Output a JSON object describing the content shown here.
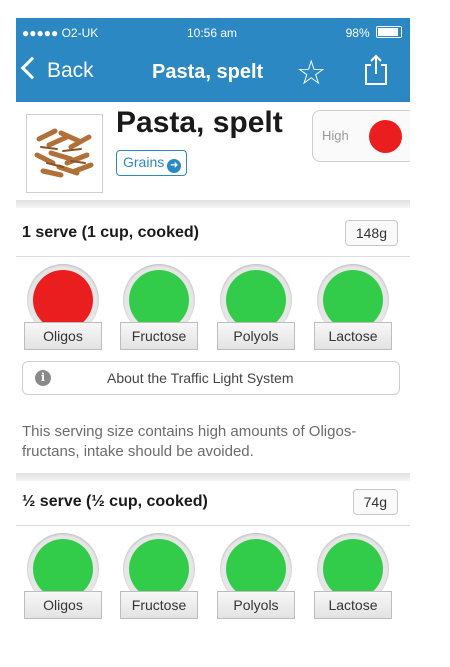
{
  "status_bar": {
    "carrier": "●●●●● O2-UK",
    "time": "10:56 am",
    "battery": "98%"
  },
  "nav": {
    "back_label": "Back",
    "title": "Pasta, spelt"
  },
  "food": {
    "name": "Pasta, spelt",
    "category": "Grains",
    "rating_label": "High",
    "rating_color": "#ea1e1e"
  },
  "servings": [
    {
      "label": "1 serve (1 cup, cooked)",
      "weight": "148g",
      "lights": [
        {
          "name": "Oligos",
          "color": "#ea1e1e"
        },
        {
          "name": "Fructose",
          "color": "#33cc4a"
        },
        {
          "name": "Polyols",
          "color": "#33cc4a"
        },
        {
          "name": "Lactose",
          "color": "#33cc4a"
        }
      ]
    },
    {
      "label": "½ serve (½ cup, cooked)",
      "weight": "74g",
      "lights": [
        {
          "name": "Oligos",
          "color": "#33cc4a"
        },
        {
          "name": "Fructose",
          "color": "#33cc4a"
        },
        {
          "name": "Polyols",
          "color": "#33cc4a"
        },
        {
          "name": "Lactose",
          "color": "#33cc4a"
        }
      ]
    }
  ],
  "about_button": "About the Traffic Light System",
  "advice": "This serving size contains high amounts of Oligos-fructans, intake should be avoided.",
  "colors": {
    "nav_bar": "#2b88c3",
    "high": "#ea1e1e",
    "low": "#33cc4a"
  }
}
